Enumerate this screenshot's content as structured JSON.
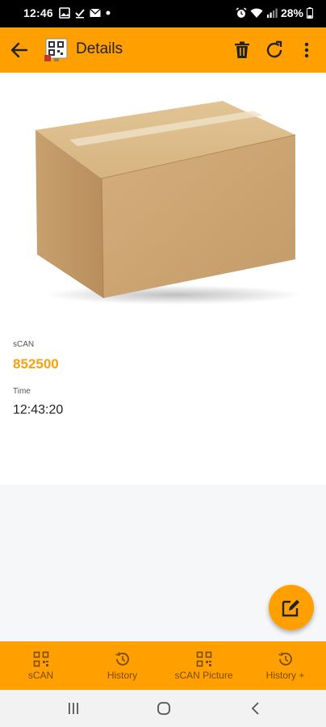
{
  "status_bar": {
    "time": "12:46",
    "battery": "28%",
    "left_icons": [
      "gallery-icon",
      "checkmark-icon",
      "mail-icon",
      "dot-icon"
    ],
    "right_icons": [
      "alarm-icon",
      "wifi-icon",
      "signal-icon",
      "battery-icon"
    ]
  },
  "app_bar": {
    "title": "Details",
    "actions": [
      "delete-icon",
      "refresh-icon",
      "more-vert-icon"
    ],
    "accent": "#FFA000"
  },
  "details": {
    "scan_label": "sCAN",
    "scan_value": "852500",
    "time_label": "Time",
    "time_value": "12:43:20",
    "value_color": "#F7A20A"
  },
  "bottom_nav": {
    "items": [
      {
        "label": "sCAN",
        "icon": "qr-code-icon"
      },
      {
        "label": "History",
        "icon": "history-icon"
      },
      {
        "label": "sCAN Picture",
        "icon": "qr-code-icon"
      },
      {
        "label": "History +",
        "icon": "history-icon"
      }
    ]
  },
  "system_nav": [
    "recents-icon",
    "home-icon",
    "back-icon"
  ]
}
